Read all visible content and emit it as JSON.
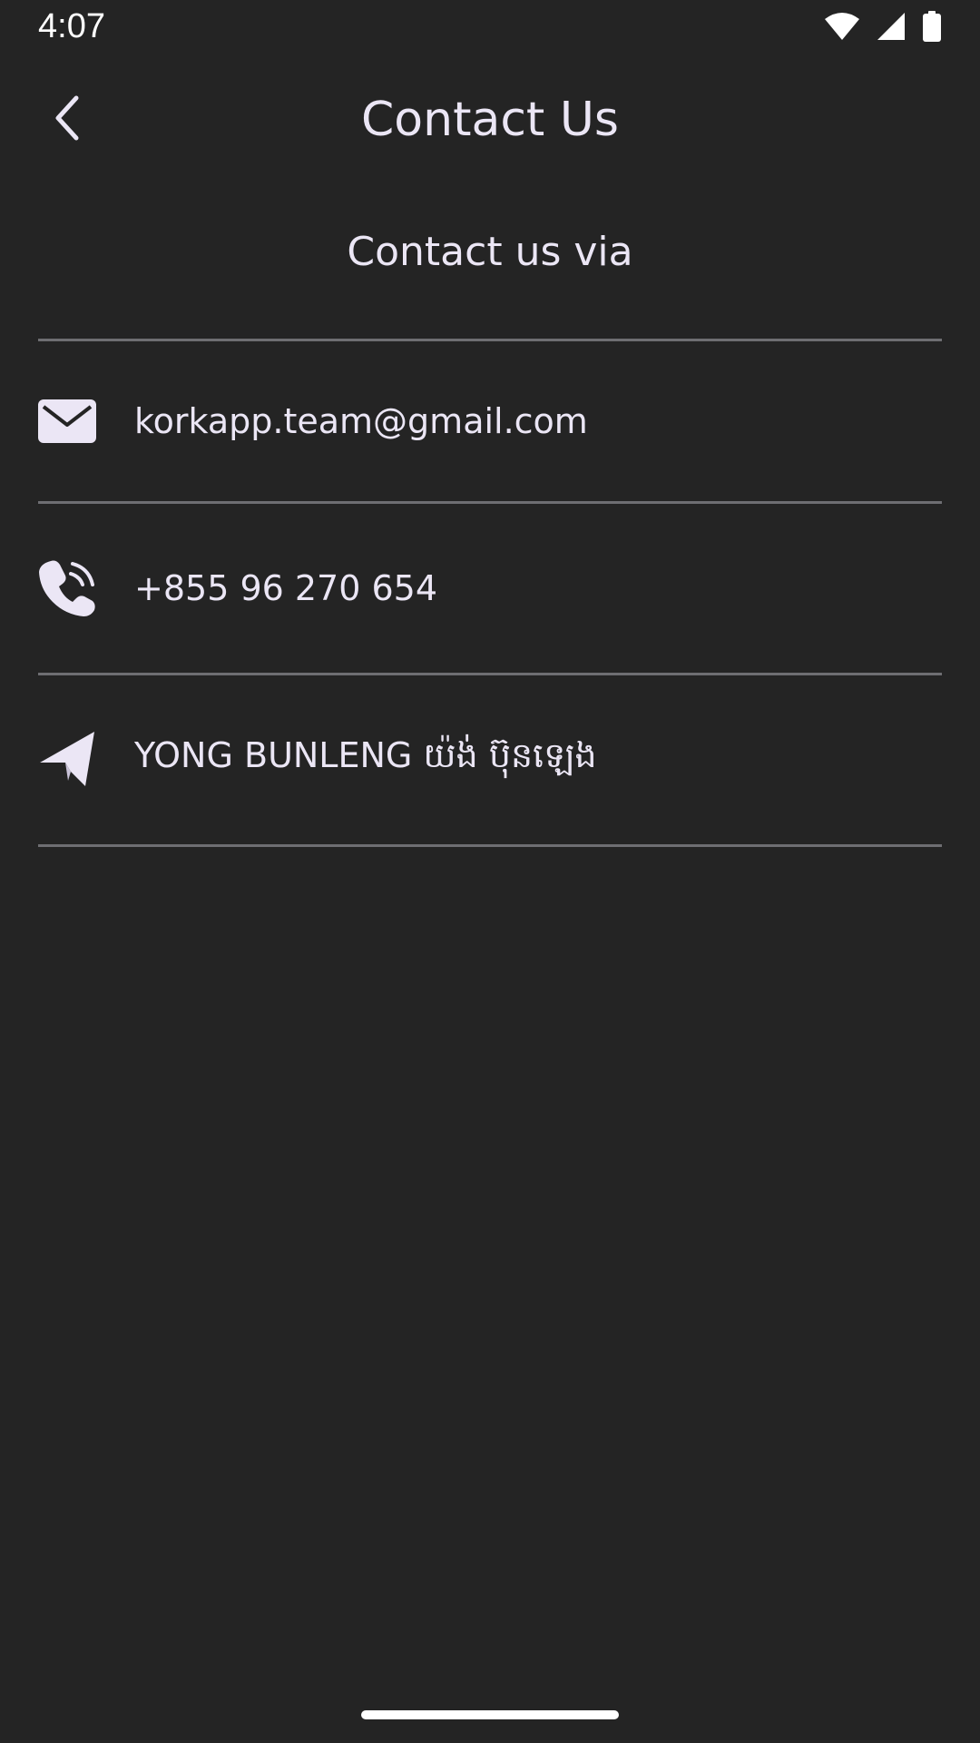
{
  "status_bar": {
    "time": "4:07",
    "icons": [
      "wifi-icon",
      "cellular-signal-icon",
      "battery-icon"
    ]
  },
  "app_bar": {
    "back_icon": "chevron-left-icon",
    "title": "Contact Us"
  },
  "section": {
    "heading": "Contact us via"
  },
  "contacts": [
    {
      "icon": "email-icon",
      "label": "korkapp.team@gmail.com"
    },
    {
      "icon": "phone-icon",
      "label": "+855 96 270 654"
    },
    {
      "icon": "telegram-icon",
      "label": "YONG BUNLENG យ៉ង់ ប៊ុនឡេង"
    }
  ],
  "colors": {
    "background": "#242424",
    "text": "#ebe6f5",
    "divider": "#6e6e72",
    "icon": "#ebe6f5"
  }
}
